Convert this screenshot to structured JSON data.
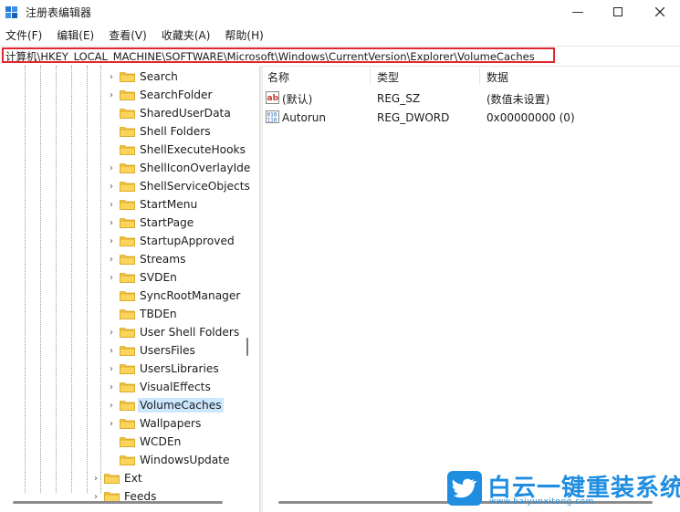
{
  "window": {
    "title": "注册表编辑器"
  },
  "menu": [
    "文件(F)",
    "编辑(E)",
    "查看(V)",
    "收藏夹(A)",
    "帮助(H)"
  ],
  "address": "计算机\\HKEY_LOCAL_MACHINE\\SOFTWARE\\Microsoft\\Windows\\CurrentVersion\\Explorer\\VolumeCaches",
  "tree": {
    "items": [
      {
        "label": "Search",
        "expandable": true
      },
      {
        "label": "SearchFolder",
        "expandable": true
      },
      {
        "label": "SharedUserData",
        "expandable": false
      },
      {
        "label": "Shell Folders",
        "expandable": false
      },
      {
        "label": "ShellExecuteHooks",
        "expandable": false
      },
      {
        "label": "ShellIconOverlayIde",
        "expandable": true
      },
      {
        "label": "ShellServiceObjects",
        "expandable": true
      },
      {
        "label": "StartMenu",
        "expandable": true
      },
      {
        "label": "StartPage",
        "expandable": true
      },
      {
        "label": "StartupApproved",
        "expandable": true
      },
      {
        "label": "Streams",
        "expandable": true
      },
      {
        "label": "SVDEn",
        "expandable": true
      },
      {
        "label": "SyncRootManager",
        "expandable": false
      },
      {
        "label": "TBDEn",
        "expandable": false
      },
      {
        "label": "User Shell Folders",
        "expandable": true
      },
      {
        "label": "UsersFiles",
        "expandable": true
      },
      {
        "label": "UsersLibraries",
        "expandable": true
      },
      {
        "label": "VisualEffects",
        "expandable": true
      },
      {
        "label": "VolumeCaches",
        "expandable": true,
        "selected": true
      },
      {
        "label": "Wallpapers",
        "expandable": true
      },
      {
        "label": "WCDEn",
        "expandable": false
      },
      {
        "label": "WindowsUpdate",
        "expandable": false
      }
    ],
    "parent_items": [
      {
        "label": "Ext",
        "expandable": true
      },
      {
        "label": "Feeds",
        "expandable": true
      }
    ]
  },
  "values_pane": {
    "columns": [
      "名称",
      "类型",
      "数据"
    ],
    "rows": [
      {
        "name": "(默认)",
        "type": "REG_SZ",
        "data": "(数值未设置)",
        "icon": "string-value-icon"
      },
      {
        "name": "Autorun",
        "type": "REG_DWORD",
        "data": "0x00000000 (0)",
        "icon": "dword-value-icon"
      }
    ]
  },
  "watermark": {
    "title": "白云一键重装系统",
    "url": "www.baiyunxitong.com"
  },
  "colors": {
    "highlight_border": "#e0272d",
    "selection": "#cce8ff",
    "folder": "#f5c542",
    "watermark": "#1f8de0"
  }
}
